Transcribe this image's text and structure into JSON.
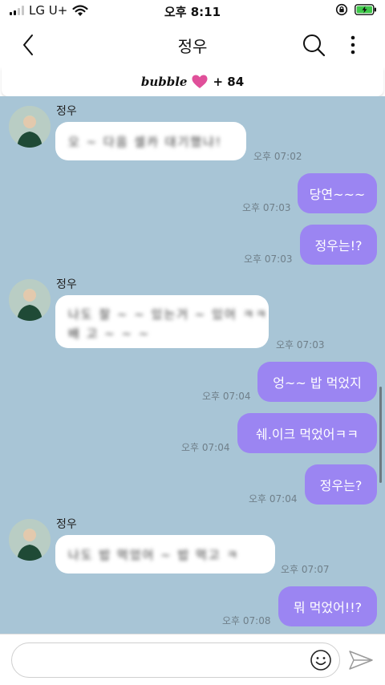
{
  "status_bar": {
    "carrier": "LG U+",
    "time": "오후 8:11",
    "signal_bars_active": 2
  },
  "header": {
    "title": "정우",
    "back_icon": "chevron-left-icon",
    "search_icon": "search-icon",
    "more_icon": "more-vertical-icon"
  },
  "banner": {
    "logo": "bubble",
    "heart_icon": "heart-icon",
    "count": "+ 84"
  },
  "colors": {
    "chat_background": "#a8c5d6",
    "outgoing_bubble": "#9b85f2",
    "incoming_bubble": "#ffffff",
    "heart": "#e0509a"
  },
  "messages": [
    {
      "sender": "정우",
      "text": "오 ~ 다음 셀카 대기했냐!",
      "time": "오후 07:02"
    },
    {
      "text": "당연~~~",
      "time": "오후 07:03"
    },
    {
      "text": "정우는!?",
      "time": "오후 07:03"
    },
    {
      "sender": "정우",
      "line1": "나도 잘 ~ ~ 있는거 ~ 있어 ㅋㅋ",
      "line2": "배 고 ~ ~ ~",
      "time": "오후 07:03"
    },
    {
      "text": "엉~~ 밥 먹었지",
      "time": "오후 07:04"
    },
    {
      "text": "쉐.이크 먹었어ㅋㅋ",
      "time": "오후 07:04"
    },
    {
      "text": "정우는?",
      "time": "오후 07:04"
    },
    {
      "sender": "정우",
      "text": "나도 밥 먹었어 ~ 밥 먹고 ㅋ",
      "time": "오후 07:07"
    },
    {
      "text": "뭐 먹었어!!?",
      "time": "오후 07:08"
    }
  ],
  "input": {
    "value": "",
    "placeholder": "",
    "emoji_icon": "smiley-icon",
    "send_icon": "send-icon"
  }
}
